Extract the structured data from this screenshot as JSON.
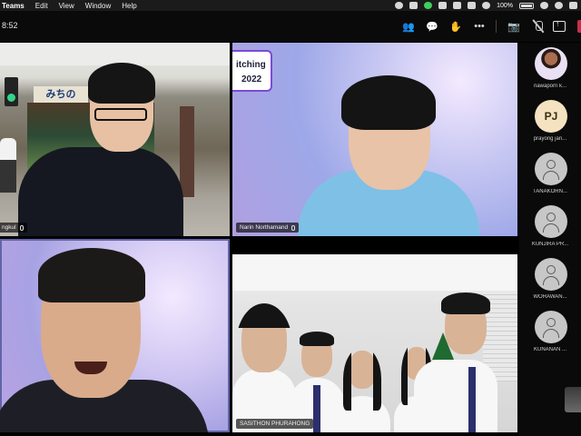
{
  "menubar": {
    "app_name": "Teams",
    "menu_items": [
      "Edit",
      "View",
      "Window",
      "Help"
    ],
    "battery": "100%"
  },
  "toolbar": {
    "timer": "8:52"
  },
  "tiles": [
    {
      "name": "ngkul"
    },
    {
      "name": "Narin Northamand"
    },
    {
      "name": ""
    },
    {
      "name": "SASITHON PHURAHONG"
    }
  ],
  "pitch_badge": {
    "line1": "itching",
    "line2": "2022"
  },
  "shop_sign": "みちの",
  "participants": [
    {
      "name": "nawaporn k...",
      "avatar": "photo"
    },
    {
      "name": "prayong jan...",
      "avatar": "initials",
      "initials": "PJ"
    },
    {
      "name": "TANAKORN...",
      "avatar": "generic"
    },
    {
      "name": "KUNJIRA PR...",
      "avatar": "generic"
    },
    {
      "name": "WORAWAN...",
      "avatar": "generic"
    },
    {
      "name": "KUNANAN ...",
      "avatar": "generic"
    }
  ],
  "colors": {
    "accent": "#6264a7",
    "leave": "#c4314b",
    "background": "#0a0a0a"
  }
}
